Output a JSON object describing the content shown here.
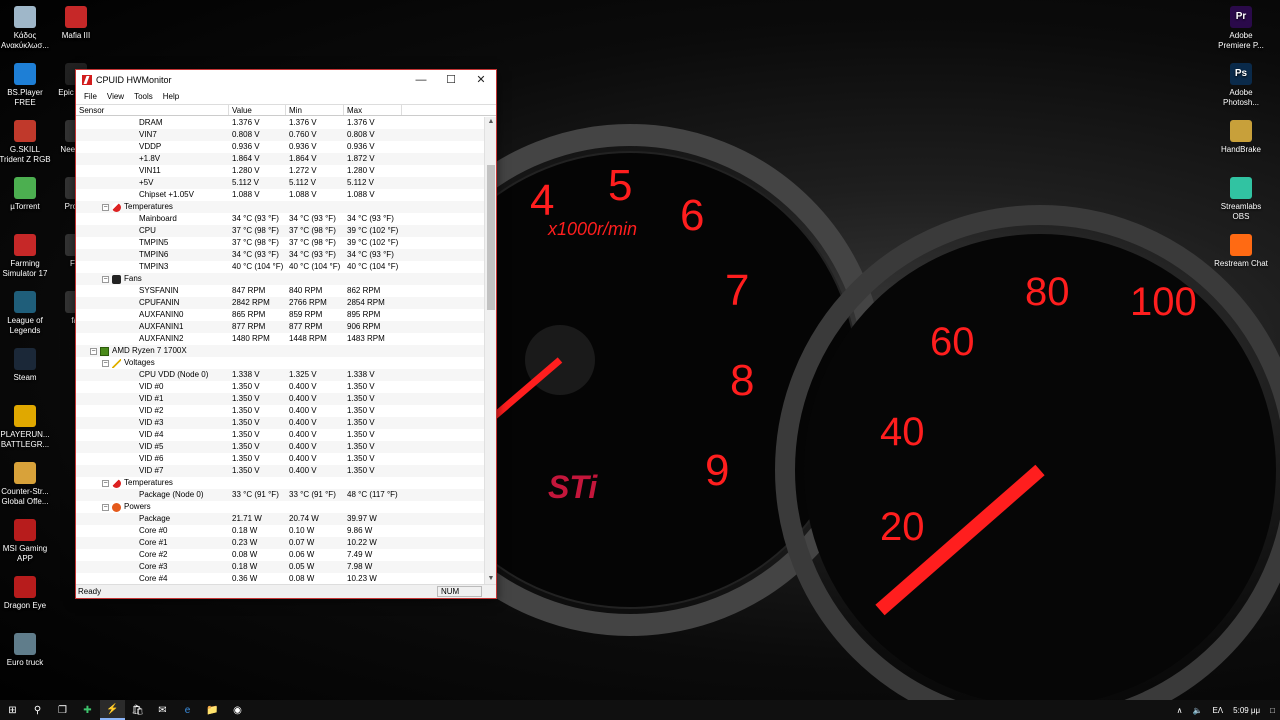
{
  "desktop": {
    "left_icons": [
      {
        "label": "Κάδος Ανακύκλωσ...",
        "icon": "recycle-bin-icon",
        "color": "#9fb7c9"
      },
      {
        "label": "BS.Player FREE",
        "icon": "bsplayer-icon",
        "color": "#1e7fd6"
      },
      {
        "label": "G.SKILL Trident Z RGB",
        "icon": "gskill-icon",
        "color": "#c0392b"
      },
      {
        "label": "µTorrent",
        "icon": "utorrent-icon",
        "color": "#4caf50"
      },
      {
        "label": "Farming Simulator 17",
        "icon": "farming-simulator-icon",
        "color": "#c62828"
      },
      {
        "label": "League of Legends",
        "icon": "league-of-legends-icon",
        "color": "#1f5e7a"
      },
      {
        "label": "Steam",
        "icon": "steam-icon",
        "color": "#1b2838"
      },
      {
        "label": "PLAYERUN... BATTLEGR...",
        "icon": "pubg-icon",
        "color": "#e0a800"
      },
      {
        "label": "Counter-Str... Global Offe...",
        "icon": "csgo-icon",
        "color": "#d8a23a"
      },
      {
        "label": "MSI Gaming APP",
        "icon": "msi-gaming-icon",
        "color": "#b71c1c"
      },
      {
        "label": "Dragon Eye",
        "icon": "dragon-eye-icon",
        "color": "#b71c1c"
      },
      {
        "label": "Euro truck",
        "icon": "euro-truck-icon",
        "color": "#607d8b"
      }
    ],
    "second_column_icons": [
      {
        "label": "Mafia III",
        "icon": "mafia-icon",
        "color": "#c62828"
      },
      {
        "label": "Epic Laun",
        "icon": "epic-games-icon",
        "color": "#222222"
      },
      {
        "label": "Nee Spe",
        "icon": "need-for-speed-icon",
        "color": "#333333"
      },
      {
        "label": "Projec",
        "icon": "project-cars-icon",
        "color": "#333333"
      },
      {
        "label": "Far",
        "icon": "farming-icon",
        "color": "#333333"
      },
      {
        "label": "far",
        "icon": "farming-2-icon",
        "color": "#333333"
      }
    ],
    "right_icons": [
      {
        "label": "Adobe Premiere P...",
        "icon": "premiere-icon",
        "color": "#2a0a4a",
        "glyph": "Pr"
      },
      {
        "label": "Adobe Photosh...",
        "icon": "photoshop-icon",
        "color": "#0a2a4a",
        "glyph": "Ps"
      },
      {
        "label": "HandBrake",
        "icon": "handbrake-icon",
        "color": "#c8a03a",
        "glyph": ""
      },
      {
        "label": "Streamlabs OBS",
        "icon": "streamlabs-icon",
        "color": "#31c3a2",
        "glyph": ""
      },
      {
        "label": "Restream Chat",
        "icon": "restream-icon",
        "color": "#ff6a13",
        "glyph": ""
      }
    ]
  },
  "window": {
    "title": "CPUID HWMonitor",
    "menu": [
      "File",
      "View",
      "Tools",
      "Help"
    ],
    "columns": [
      "Sensor",
      "Value",
      "Min",
      "Max"
    ],
    "status": "Ready",
    "num_indicator": "NUM",
    "rows": [
      {
        "level": 3,
        "name": "DRAM",
        "value": "1.376 V",
        "min": "1.376 V",
        "max": "1.376 V"
      },
      {
        "level": 3,
        "name": "VIN7",
        "value": "0.808 V",
        "min": "0.760 V",
        "max": "0.808 V"
      },
      {
        "level": 3,
        "name": "VDDP",
        "value": "0.936 V",
        "min": "0.936 V",
        "max": "0.936 V"
      },
      {
        "level": 3,
        "name": "+1.8V",
        "value": "1.864 V",
        "min": "1.864 V",
        "max": "1.872 V"
      },
      {
        "level": 3,
        "name": "VIN11",
        "value": "1.280 V",
        "min": "1.272 V",
        "max": "1.280 V"
      },
      {
        "level": 3,
        "name": "+5V",
        "value": "5.112 V",
        "min": "5.112 V",
        "max": "5.112 V"
      },
      {
        "level": 3,
        "name": "Chipset +1.05V",
        "value": "1.088 V",
        "min": "1.088 V",
        "max": "1.088 V"
      },
      {
        "level": 2,
        "name": "Temperatures",
        "icon": "thermometer-icon",
        "value": "",
        "min": "",
        "max": ""
      },
      {
        "level": 3,
        "name": "Mainboard",
        "value": "34 °C  (93 °F)",
        "min": "34 °C  (93 °F)",
        "max": "34 °C  (93 °F)"
      },
      {
        "level": 3,
        "name": "CPU",
        "value": "37 °C  (98 °F)",
        "min": "37 °C  (98 °F)",
        "max": "39 °C  (102 °F)"
      },
      {
        "level": 3,
        "name": "TMPIN5",
        "value": "37 °C  (98 °F)",
        "min": "37 °C  (98 °F)",
        "max": "39 °C  (102 °F)"
      },
      {
        "level": 3,
        "name": "TMPIN6",
        "value": "34 °C  (93 °F)",
        "min": "34 °C  (93 °F)",
        "max": "34 °C  (93 °F)"
      },
      {
        "level": 3,
        "name": "TMPIN3",
        "value": "40 °C  (104 °F)",
        "min": "40 °C  (104 °F)",
        "max": "40 °C  (104 °F)"
      },
      {
        "level": 2,
        "name": "Fans",
        "icon": "fan-icon",
        "value": "",
        "min": "",
        "max": ""
      },
      {
        "level": 3,
        "name": "SYSFANIN",
        "value": "847 RPM",
        "min": "840 RPM",
        "max": "862 RPM"
      },
      {
        "level": 3,
        "name": "CPUFANIN",
        "value": "2842 RPM",
        "min": "2766 RPM",
        "max": "2854 RPM"
      },
      {
        "level": 3,
        "name": "AUXFANIN0",
        "value": "865 RPM",
        "min": "859 RPM",
        "max": "895 RPM"
      },
      {
        "level": 3,
        "name": "AUXFANIN1",
        "value": "877 RPM",
        "min": "877 RPM",
        "max": "906 RPM"
      },
      {
        "level": 3,
        "name": "AUXFANIN2",
        "value": "1480 RPM",
        "min": "1448 RPM",
        "max": "1483 RPM"
      },
      {
        "level": 1,
        "name": "AMD Ryzen 7 1700X",
        "icon": "cpu-chip-icon",
        "value": "",
        "min": "",
        "max": ""
      },
      {
        "level": 2,
        "name": "Voltages",
        "icon": "voltage-icon",
        "value": "",
        "min": "",
        "max": ""
      },
      {
        "level": 3,
        "name": "CPU VDD (Node 0)",
        "value": "1.338 V",
        "min": "1.325 V",
        "max": "1.338 V"
      },
      {
        "level": 3,
        "name": "VID #0",
        "value": "1.350 V",
        "min": "0.400 V",
        "max": "1.350 V"
      },
      {
        "level": 3,
        "name": "VID #1",
        "value": "1.350 V",
        "min": "0.400 V",
        "max": "1.350 V"
      },
      {
        "level": 3,
        "name": "VID #2",
        "value": "1.350 V",
        "min": "0.400 V",
        "max": "1.350 V"
      },
      {
        "level": 3,
        "name": "VID #3",
        "value": "1.350 V",
        "min": "0.400 V",
        "max": "1.350 V"
      },
      {
        "level": 3,
        "name": "VID #4",
        "value": "1.350 V",
        "min": "0.400 V",
        "max": "1.350 V"
      },
      {
        "level": 3,
        "name": "VID #5",
        "value": "1.350 V",
        "min": "0.400 V",
        "max": "1.350 V"
      },
      {
        "level": 3,
        "name": "VID #6",
        "value": "1.350 V",
        "min": "0.400 V",
        "max": "1.350 V"
      },
      {
        "level": 3,
        "name": "VID #7",
        "value": "1.350 V",
        "min": "0.400 V",
        "max": "1.350 V"
      },
      {
        "level": 2,
        "name": "Temperatures",
        "icon": "thermometer-icon",
        "value": "",
        "min": "",
        "max": ""
      },
      {
        "level": 3,
        "name": "Package (Node 0)",
        "value": "33 °C  (91 °F)",
        "min": "33 °C  (91 °F)",
        "max": "48 °C  (117 °F)"
      },
      {
        "level": 2,
        "name": "Powers",
        "icon": "power-icon",
        "value": "",
        "min": "",
        "max": ""
      },
      {
        "level": 3,
        "name": "Package",
        "value": "21.71 W",
        "min": "20.74 W",
        "max": "39.97 W"
      },
      {
        "level": 3,
        "name": "Core #0",
        "value": "0.18 W",
        "min": "0.10 W",
        "max": "9.86 W"
      },
      {
        "level": 3,
        "name": "Core #1",
        "value": "0.23 W",
        "min": "0.07 W",
        "max": "10.22 W"
      },
      {
        "level": 3,
        "name": "Core #2",
        "value": "0.08 W",
        "min": "0.06 W",
        "max": "7.49 W"
      },
      {
        "level": 3,
        "name": "Core #3",
        "value": "0.18 W",
        "min": "0.05 W",
        "max": "7.98 W"
      },
      {
        "level": 3,
        "name": "Core #4",
        "value": "0.36 W",
        "min": "0.08 W",
        "max": "10.23 W"
      }
    ]
  },
  "taskbar": {
    "items": [
      {
        "name": "start-button",
        "icon": "windows-logo-icon",
        "glyph": "⊞"
      },
      {
        "name": "search-button",
        "icon": "search-icon",
        "glyph": "⚲"
      },
      {
        "name": "task-view-button",
        "icon": "task-view-icon",
        "glyph": "❐"
      },
      {
        "name": "taskbar-app-1",
        "icon": "green-plus-icon",
        "glyph": "✚"
      },
      {
        "name": "taskbar-hwmonitor",
        "icon": "hwmonitor-icon",
        "glyph": "⚡",
        "active": true
      },
      {
        "name": "taskbar-store",
        "icon": "store-icon",
        "glyph": "🛍"
      },
      {
        "name": "taskbar-mail",
        "icon": "mail-icon",
        "glyph": "✉"
      },
      {
        "name": "taskbar-edge",
        "icon": "edge-icon",
        "glyph": "e"
      },
      {
        "name": "taskbar-explorer",
        "icon": "folder-icon",
        "glyph": "📁"
      },
      {
        "name": "taskbar-chrome",
        "icon": "chrome-icon",
        "glyph": "◉"
      }
    ],
    "tray": {
      "language": "ΕΛ",
      "time": "5:09 μμ"
    }
  },
  "wallpaper": {
    "accent_color": "#ff1e1e",
    "gauge_labels_left": [
      "4",
      "5",
      "6",
      "7",
      "8",
      "9"
    ],
    "gauge_unit_left": "x1000r/min",
    "gauge_labels_right": [
      "20",
      "40",
      "60",
      "80",
      "100"
    ],
    "brand": "STi"
  }
}
